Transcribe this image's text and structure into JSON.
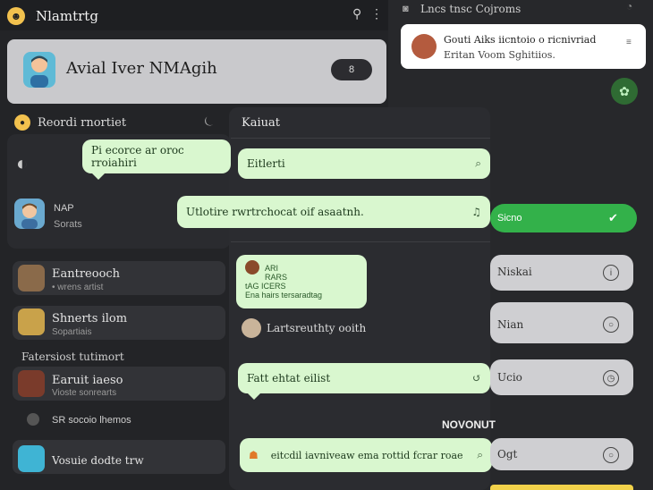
{
  "app": {
    "title": "Nlamtrtg"
  },
  "profile": {
    "name": "Avial Iver NMAgih",
    "button_label": "8"
  },
  "section": {
    "title": "Reordi rnortiet"
  },
  "contact": {
    "name": "NAP",
    "subtitle": "Sorats"
  },
  "list": [
    {
      "title": "Eantreooch",
      "sub": "• wrens artist"
    },
    {
      "title": "Shnerts ilom",
      "sub": "Sopartiais"
    },
    {
      "title": "Earuit iaeso",
      "sub": "Vioste sonrearts"
    }
  ],
  "list_label": "Fatersiost tutimort",
  "plain_row": "SR socoio lhemos",
  "bottom_item": "Vosuie dodte trw",
  "chat": {
    "title": "Kaiuat",
    "bubble1": "Pi ecorce ar oroc rroiahiri",
    "bubble2": "Eitlerti",
    "bubble3": "Utlotire rwrtrchocat oif asaatnh.",
    "bubble4_lines": [
      "ARI",
      "RARS",
      "tAG ICERS",
      "Ena hairs tersaradtag"
    ],
    "sender_name": "Lartsreuthty ooith",
    "bubble5": "Fatt ehtat eilist",
    "section_tag": "NOVONUT",
    "bubble6": "eitcdil iavniveaw ema rottid fcrar roae"
  },
  "right": {
    "header": "Lncs tnsc Cojroms",
    "notification": {
      "line1": "Gouti Aiks iicntoio o ricnivriad",
      "line2": "Eritan Voom Sghitiios."
    },
    "pill_green": "Sicno",
    "pills": [
      "Niskai",
      "Nian",
      "Ucio",
      "Ogt"
    ]
  },
  "colors": {
    "accent_green": "#33b14a",
    "bubble": "#d9f7cf",
    "brand_yellow": "#f2c14e"
  }
}
